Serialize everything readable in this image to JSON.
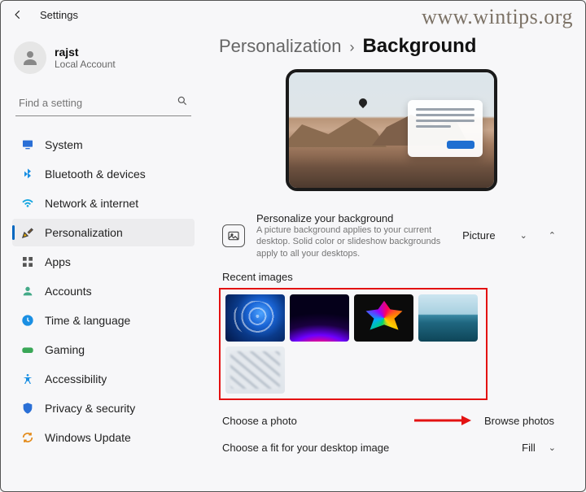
{
  "watermark": "www.wintips.org",
  "title": "Settings",
  "account": {
    "name": "rajst",
    "type": "Local Account"
  },
  "search": {
    "placeholder": "Find a setting"
  },
  "nav": [
    {
      "label": "System"
    },
    {
      "label": "Bluetooth & devices"
    },
    {
      "label": "Network & internet"
    },
    {
      "label": "Personalization"
    },
    {
      "label": "Apps"
    },
    {
      "label": "Accounts"
    },
    {
      "label": "Time & language"
    },
    {
      "label": "Gaming"
    },
    {
      "label": "Accessibility"
    },
    {
      "label": "Privacy & security"
    },
    {
      "label": "Windows Update"
    }
  ],
  "breadcrumb": {
    "parent": "Personalization",
    "sep": "›",
    "current": "Background"
  },
  "personalize": {
    "title": "Personalize your background",
    "desc": "A picture background applies to your current desktop. Solid color or slideshow backgrounds apply to all your desktops.",
    "value": "Picture"
  },
  "recent_label": "Recent images",
  "choose_photo": {
    "label": "Choose a photo",
    "button": "Browse photos"
  },
  "fit": {
    "label": "Choose a fit for your desktop image",
    "value": "Fill"
  }
}
